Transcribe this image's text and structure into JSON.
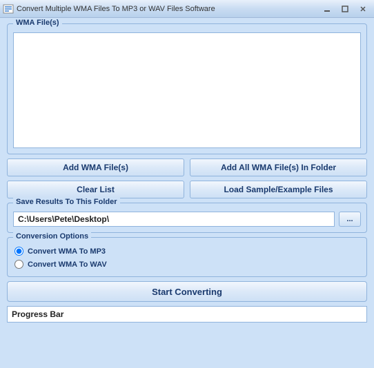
{
  "window": {
    "title": "Convert Multiple WMA Files To MP3 or WAV Files Software"
  },
  "file_group": {
    "label": "WMA File(s)"
  },
  "buttons": {
    "add_files": "Add WMA File(s)",
    "add_folder": "Add All WMA File(s) In Folder",
    "clear_list": "Clear List",
    "load_sample": "Load Sample/Example Files",
    "browse": "...",
    "start": "Start Converting"
  },
  "save_group": {
    "label": "Save Results To This Folder",
    "path": "C:\\Users\\Pete\\Desktop\\"
  },
  "options_group": {
    "label": "Conversion Options",
    "to_mp3": "Convert WMA To MP3",
    "to_wav": "Convert WMA To WAV",
    "selected": "mp3"
  },
  "progress": {
    "label": "Progress Bar"
  }
}
